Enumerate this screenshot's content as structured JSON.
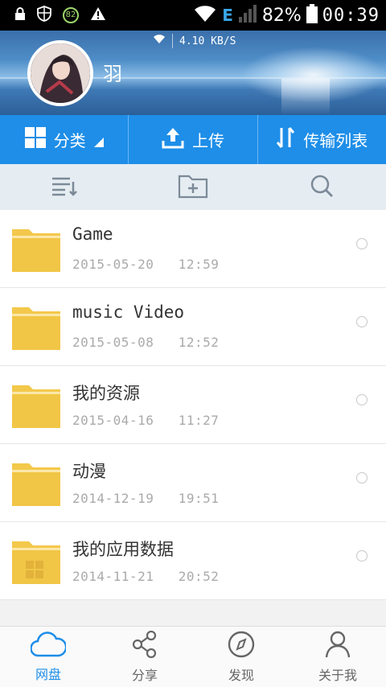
{
  "status_bar": {
    "badge": "82",
    "battery": "82%",
    "time": "00:39",
    "network": "E"
  },
  "header": {
    "speed": "4.10 KB/S",
    "username": "羽"
  },
  "actions": [
    {
      "label": "分类",
      "icon": "grid-icon"
    },
    {
      "label": "上传",
      "icon": "upload-icon"
    },
    {
      "label": "传输列表",
      "icon": "transfer-icon"
    }
  ],
  "toolbar": {
    "icons": [
      "sort-list-icon",
      "new-folder-icon",
      "search-icon"
    ]
  },
  "files": [
    {
      "name": "Game",
      "date": "2015-05-20",
      "time": "12:59"
    },
    {
      "name": "music Video",
      "date": "2015-05-08",
      "time": "12:52"
    },
    {
      "name": "我的资源",
      "date": "2015-04-16",
      "time": "11:27"
    },
    {
      "name": "动漫",
      "date": "2014-12-19",
      "time": "19:51"
    },
    {
      "name": "我的应用数据",
      "date": "2014-11-21",
      "time": "20:52"
    }
  ],
  "bottom_nav": [
    {
      "label": "网盘",
      "icon": "cloud-icon",
      "active": true
    },
    {
      "label": "分享",
      "icon": "share-icon",
      "active": false
    },
    {
      "label": "发现",
      "icon": "compass-icon",
      "active": false
    },
    {
      "label": "关于我",
      "icon": "person-icon",
      "active": false
    }
  ],
  "colors": {
    "accent": "#1e8ee8",
    "folder": "#f3c84b",
    "toolbar_bg": "#e6edf2"
  }
}
